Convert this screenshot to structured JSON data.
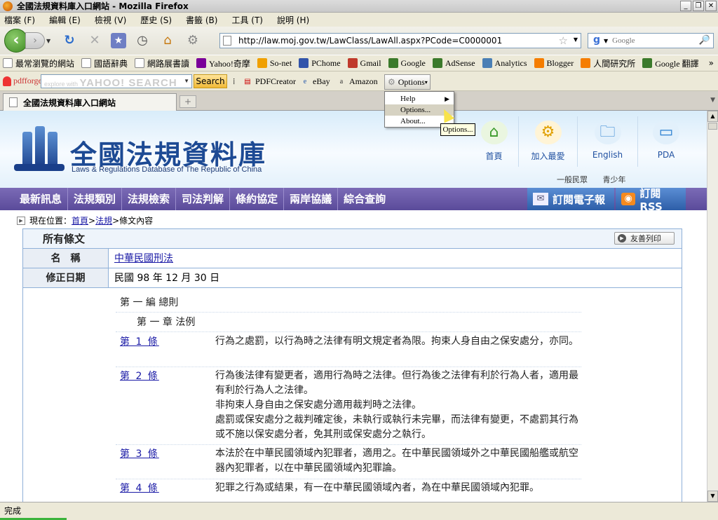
{
  "window": {
    "title": "全國法規資料庫入口網站 - Mozilla Firefox"
  },
  "menu": [
    "檔案 (F)",
    "編輯 (E)",
    "檢視 (V)",
    "歷史 (S)",
    "書籤 (B)",
    "工具 (T)",
    "說明 (H)"
  ],
  "nav": {
    "url": "http://law.moj.gov.tw/LawClass/LawAll.aspx?PCode=C0000001",
    "search_placeholder": "Google"
  },
  "bookmarks": [
    {
      "label": "最常瀏覽的網站",
      "icon": "page-icon",
      "color": "#ffffff"
    },
    {
      "label": "國語辭典",
      "icon": "page-icon",
      "color": "#ffffff"
    },
    {
      "label": "網路展書讀",
      "icon": "page-icon",
      "color": "#ffffff"
    },
    {
      "label": "Yahoo!奇摩",
      "icon": "yahoo-icon",
      "color": "#7b0099"
    },
    {
      "label": "So-net",
      "icon": "sonet-icon",
      "color": "#f0a000"
    },
    {
      "label": "PChome",
      "icon": "pchome-icon",
      "color": "#3355aa"
    },
    {
      "label": "Gmail",
      "icon": "gmail-icon",
      "color": "#c0392b"
    },
    {
      "label": "Google",
      "icon": "google-icon",
      "color": "#3b7a2b"
    },
    {
      "label": "AdSense",
      "icon": "google-icon",
      "color": "#3b7a2b"
    },
    {
      "label": "Analytics",
      "icon": "analytics-icon",
      "color": "#4a7fb5"
    },
    {
      "label": "Blogger",
      "icon": "blogger-icon",
      "color": "#f57d00"
    },
    {
      "label": "人間研究所",
      "icon": "blogger-icon",
      "color": "#f57d00"
    },
    {
      "label": "Google 翻譯",
      "icon": "google-icon",
      "color": "#3b7a2b"
    }
  ],
  "bookmarks_more": "»",
  "toolbar2": {
    "pdfforge": "pdfforge",
    "yahoo_prefix": "explore with",
    "yahoo_brand": "YAHOO! SEARCH",
    "search_button": "Search",
    "pdfcreator": "PDFCreator",
    "ebay": "eBay",
    "amazon": "Amazon",
    "options": "Options"
  },
  "dropdown": {
    "items": [
      "Help",
      "Options...",
      "About..."
    ],
    "tooltip": "Options..."
  },
  "tab": {
    "title": "全國法規資料庫入口網站",
    "new": "+"
  },
  "site": {
    "title": "全國法規資料庫",
    "subtitle": "Laws & Regulations Database of The Republic of China",
    "topnav": [
      {
        "label": "首頁",
        "icon": "home-icon"
      },
      {
        "label": "加入最愛",
        "icon": "favorite-gear-icon"
      },
      {
        "label": "English",
        "icon": "folder-icon"
      },
      {
        "label": "PDA",
        "icon": "pda-icon"
      }
    ],
    "subtabs": [
      "一般民眾",
      "青少年"
    ],
    "mainnav": [
      "最新訊息",
      "法規類別",
      "法規檢索",
      "司法判解",
      "條約協定",
      "兩岸協議",
      "綜合查詢"
    ],
    "subscribe_email": "訂閱電子報",
    "subscribe_rss": "訂閱RSS",
    "breadcrumb": {
      "prefix": "現在位置：",
      "home": "首頁",
      "sep": " > ",
      "laws": "法規",
      "current": "條文內容"
    }
  },
  "panel": {
    "title": "所有條文",
    "print": "友善列印",
    "name_label": "名　稱",
    "name_value": "中華民國刑法",
    "date_label": "修正日期",
    "date_value": "民國 98 年 12 月 30 日",
    "part": "第 一 編 總則",
    "chapter": "第 一 章 法例",
    "articles": [
      {
        "label": "第 1 條",
        "text": "行為之處罰，以行為時之法律有明文規定者為限。拘束人身自由之保安處分，亦同。"
      },
      {
        "label": "第 2 條",
        "text": "行為後法律有變更者，適用行為時之法律。但行為後之法律有利於行為人者，適用最有利於行為人之法律。\n非拘束人身自由之保安處分適用裁判時之法律。\n處罰或保安處分之裁判確定後，未執行或執行未完畢，而法律有變更，不處罰其行為或不施以保安處分者，免其刑或保安處分之執行。"
      },
      {
        "label": "第 3 條",
        "text": "本法於在中華民國領域內犯罪者，適用之。在中華民國領域外之中華民國船艦或航空器內犯罪者，以在中華民國領域內犯罪論。"
      },
      {
        "label": "第 4 條",
        "text": "犯罪之行為或結果，有一在中華民國領域內者，為在中華民國領域內犯罪。"
      }
    ]
  },
  "status": "完成"
}
